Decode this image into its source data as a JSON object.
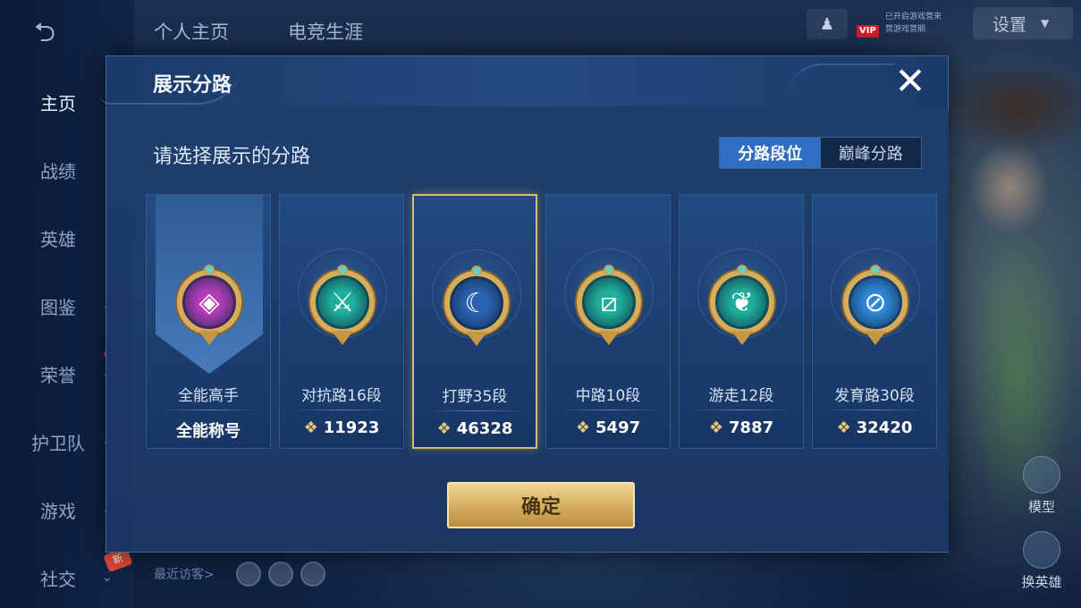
{
  "sidebar": {
    "back_icon": "back-arrow-icon",
    "items": [
      {
        "label": "主页",
        "active": true,
        "has_chevron": false,
        "is_new": false
      },
      {
        "label": "战绩",
        "active": false,
        "has_chevron": false,
        "is_new": false
      },
      {
        "label": "英雄",
        "active": false,
        "has_chevron": false,
        "is_new": false
      },
      {
        "label": "图鉴",
        "active": false,
        "has_chevron": true,
        "is_new": false
      },
      {
        "label": "荣誉",
        "active": false,
        "has_chevron": true,
        "is_new": true
      },
      {
        "label": "护卫队",
        "active": false,
        "has_chevron": true,
        "is_new": false
      },
      {
        "label": "游戏",
        "active": false,
        "has_chevron": true,
        "is_new": false
      },
      {
        "label": "社交",
        "active": false,
        "has_chevron": true,
        "is_new": true
      }
    ],
    "new_badge": "新"
  },
  "topnav": {
    "tabs": [
      "个人主页",
      "电竞生涯"
    ],
    "vip_tag": "VIP",
    "vip_line1": "已开启游戏营来",
    "vip_line2": "营游戏营期",
    "settings_label": "设置"
  },
  "bottom": {
    "recent_visitors": "最近访客>"
  },
  "side_actions": {
    "model_label": "模型",
    "switch_hero_label": "换英雄"
  },
  "modal": {
    "title": "展示分路",
    "close_icon": "close-icon",
    "subtitle": "请选择展示的分路",
    "toggle": [
      "分路段位",
      "巅峰分路"
    ],
    "toggle_active": 0,
    "confirm_label": "确定",
    "cards": [
      {
        "name": "全能高手",
        "bottom": "全能称号",
        "has_power": false,
        "selected": false,
        "badge_color": "#b43cb8",
        "icon": "all-round-icon",
        "glyph": "◈"
      },
      {
        "name": "对抗路16段",
        "bottom": "11923",
        "has_power": true,
        "selected": false,
        "badge_color": "#1fae9a",
        "icon": "clash-lane-icon",
        "glyph": "⚔"
      },
      {
        "name": "打野35段",
        "bottom": "46328",
        "has_power": true,
        "selected": true,
        "badge_color": "#2a61b0",
        "icon": "jungle-icon",
        "glyph": "☾"
      },
      {
        "name": "中路10段",
        "bottom": "5497",
        "has_power": true,
        "selected": false,
        "badge_color": "#1fae9a",
        "icon": "mid-lane-icon",
        "glyph": "⧄"
      },
      {
        "name": "游走12段",
        "bottom": "7887",
        "has_power": true,
        "selected": false,
        "badge_color": "#1fae9a",
        "icon": "roam-icon",
        "glyph": "❦"
      },
      {
        "name": "发育路30段",
        "bottom": "32420",
        "has_power": true,
        "selected": false,
        "badge_color": "#2f86d6",
        "icon": "farm-lane-icon",
        "glyph": "⊘"
      }
    ]
  }
}
